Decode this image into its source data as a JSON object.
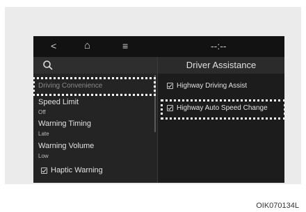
{
  "topbar": {
    "back_icon": "chevron-left-icon",
    "back_glyph": "<",
    "home_icon": "home-icon",
    "home_glyph": "⌂",
    "menu_icon": "menu-icon",
    "menu_glyph": "≡",
    "clock": "--:--"
  },
  "left_panel": {
    "search_icon": "search-icon",
    "items": [
      {
        "label": "Driving Convenience"
      },
      {
        "label": "Speed Limit",
        "value": "Off"
      },
      {
        "label": "Warning Timing",
        "value": "Late"
      },
      {
        "label": "Warning Volume",
        "value": "Low"
      },
      {
        "label": "Haptic Warning",
        "checked": true
      }
    ]
  },
  "right_panel": {
    "title": "Driver Assistance",
    "options": [
      {
        "label": "Highway Driving Assist",
        "checked": true
      },
      {
        "label": "Highway Auto Speed Change",
        "checked": true
      }
    ]
  },
  "figure_code": "OIK070134L"
}
